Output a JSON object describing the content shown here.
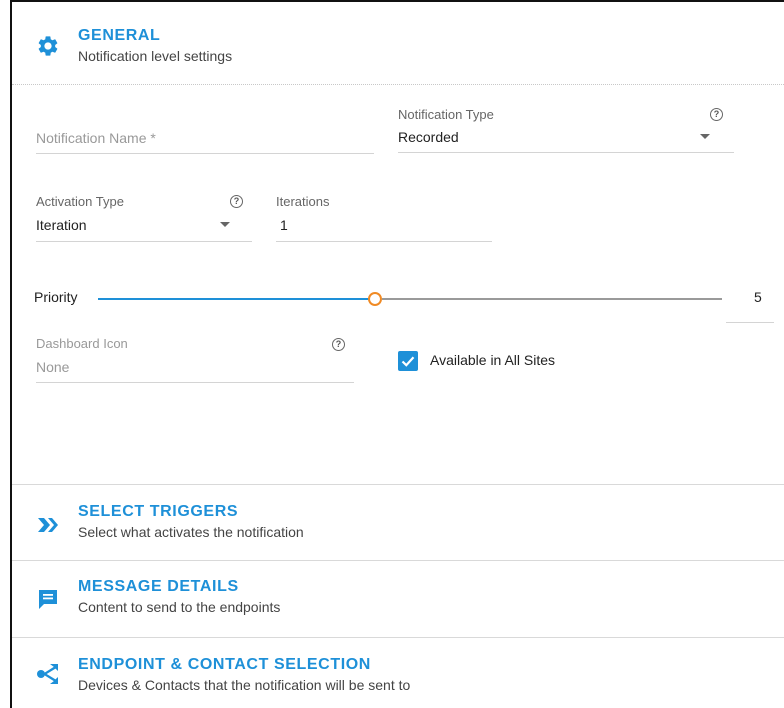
{
  "general": {
    "title": "GENERAL",
    "subtitle": "Notification level settings",
    "icon": "gear-icon"
  },
  "form": {
    "notification_name": {
      "placeholder": "Notification Name *",
      "value": ""
    },
    "notification_type": {
      "label": "Notification Type",
      "value": "Recorded"
    },
    "activation_type": {
      "label": "Activation Type",
      "value": "Iteration"
    },
    "iterations": {
      "label": "Iterations",
      "value": "1"
    },
    "priority": {
      "label": "Priority",
      "value": "5",
      "level_fraction": 0.5
    },
    "dashboard_icon": {
      "label": "Dashboard Icon",
      "value": "None"
    },
    "available_all_sites": {
      "label": "Available in All Sites",
      "checked": true
    },
    "help_glyph": "?"
  },
  "sections": [
    {
      "title": "SELECT TRIGGERS",
      "subtitle": "Select what activates the notification",
      "icon": "double-chevron-right-icon"
    },
    {
      "title": "MESSAGE DETAILS",
      "subtitle": "Content to send to the endpoints",
      "icon": "message-icon"
    },
    {
      "title": "ENDPOINT & CONTACT SELECTION",
      "subtitle": "Devices & Contacts that the notification will be sent to",
      "icon": "share-icon"
    }
  ],
  "colors": {
    "accent": "#1e90d8",
    "slider_thumb": "#f08a24"
  }
}
